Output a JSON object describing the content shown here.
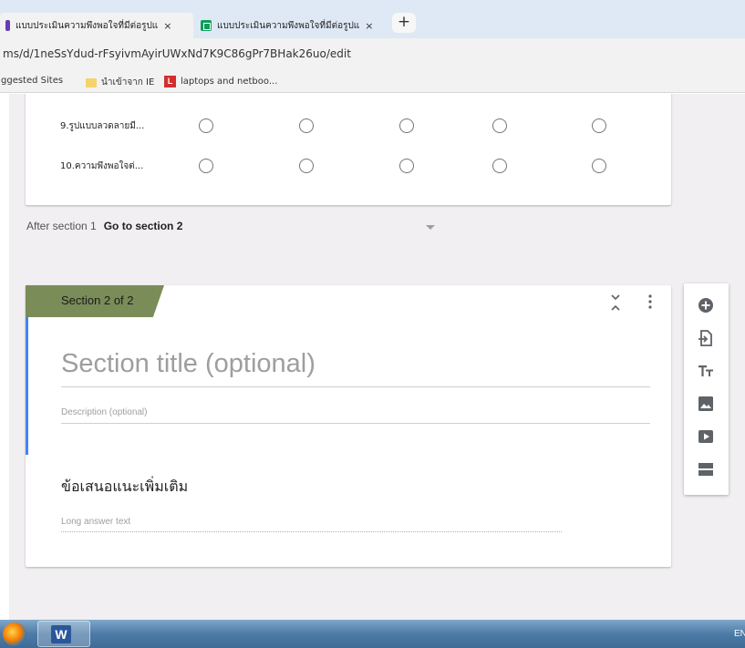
{
  "browser": {
    "tabs": [
      {
        "title": "แบบประเมินความพึงพอใจที่มีต่อรูปแ",
        "icon": "google-forms-icon"
      },
      {
        "title": "แบบประเมินความพึงพอใจที่มีต่อรูปแ",
        "icon": "google-sheets-icon"
      }
    ],
    "close_glyph": "×",
    "new_tab_glyph": "+",
    "url": "ms/d/1neSsYdud-rFsyivmAyirUWxNd7K9C86gPr7BHak26uo/edit",
    "bookmarks": [
      {
        "label": "ggested Sites"
      },
      {
        "label": "นำเข้าจาก IE",
        "icon": "folder-icon"
      },
      {
        "label": "laptops and netboo...",
        "icon": "l-logo-icon",
        "badge": "L"
      }
    ]
  },
  "grid": {
    "rows": [
      {
        "label": "9.รูปแบบลวดลายมี..."
      },
      {
        "label": "10.ความพึงพอใจต่..."
      }
    ],
    "columns_count": 5
  },
  "after_section": {
    "label": "After section 1",
    "value": "Go to section 2"
  },
  "section2": {
    "tab_label": "Section 2 of 2",
    "title_placeholder": "Section title (optional)",
    "description_placeholder": "Description (optional)",
    "question_title": "ข้อเสนอแนะเพิ่มเติม",
    "answer_placeholder": "Long answer text"
  },
  "sidebar": {
    "tools": [
      "add-question-icon",
      "import-questions-icon",
      "add-title-icon",
      "add-image-icon",
      "add-video-icon",
      "add-section-icon"
    ]
  },
  "taskbar": {
    "language": "EN",
    "word_letter": "W"
  },
  "colors": {
    "section_tab": "#7a8c58",
    "focus_bar": "#4285f4",
    "page_bg": "#f1eff1"
  }
}
